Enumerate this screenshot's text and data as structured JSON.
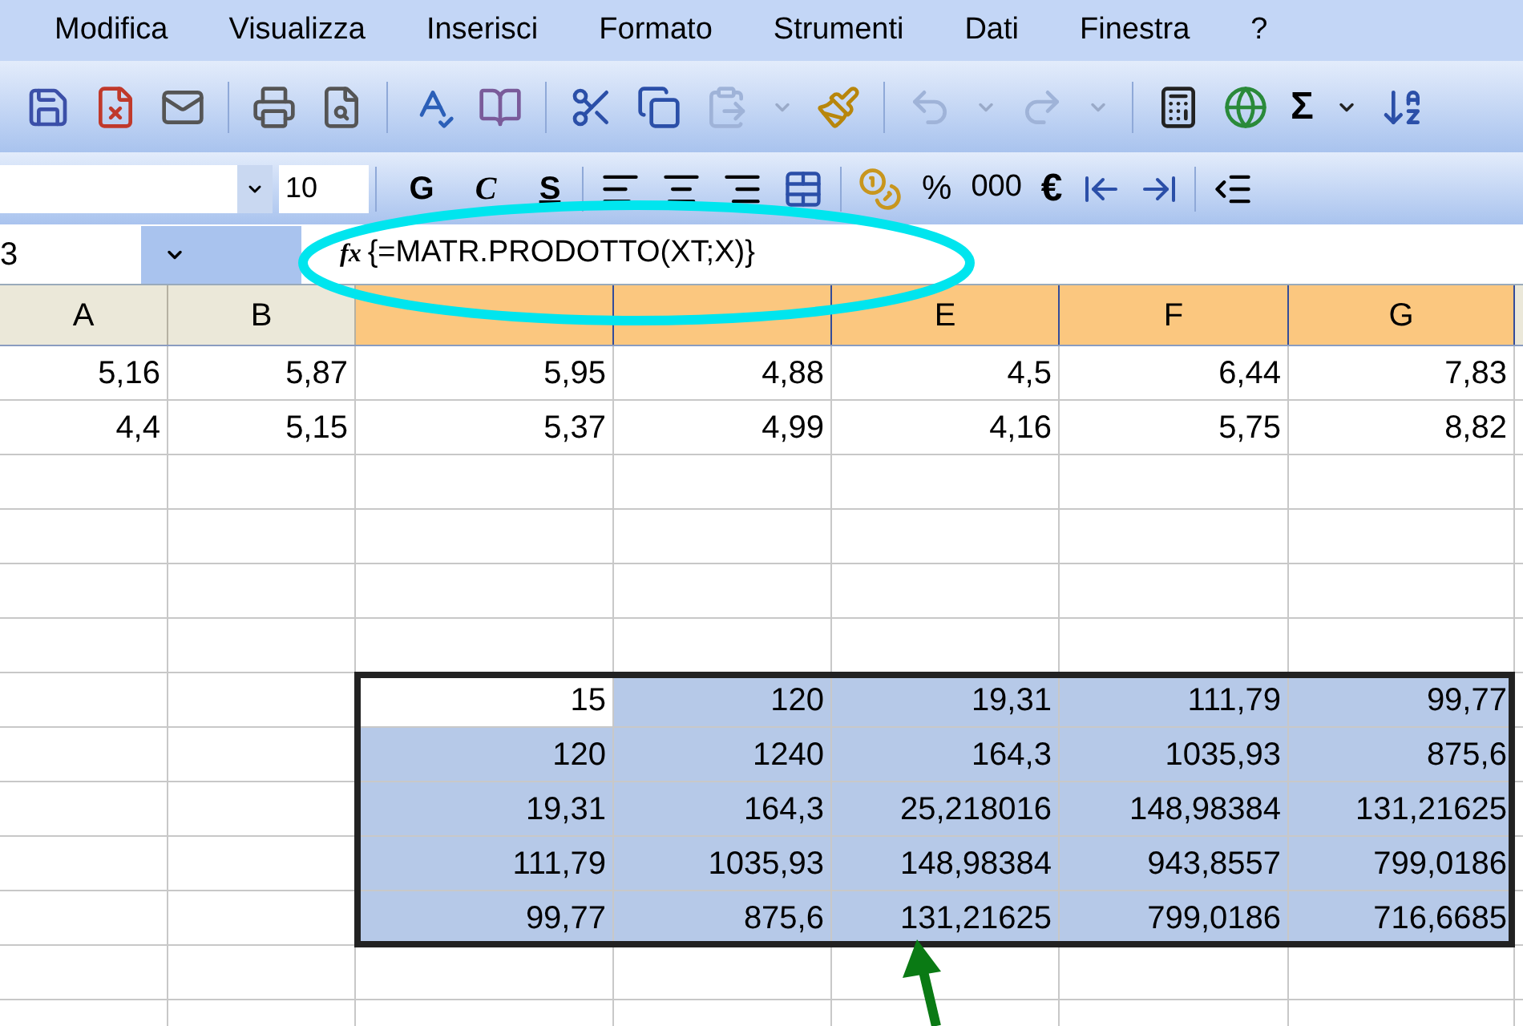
{
  "menu": [
    "Modifica",
    "Visualizza",
    "Inserisci",
    "Formato",
    "Strumenti",
    "Dati",
    "Finestra",
    "?"
  ],
  "standard_toolbar": [
    {
      "kind": "button",
      "disabled": false
    },
    {
      "kind": "button",
      "disabled": false
    },
    {
      "kind": "button",
      "disabled": false
    },
    {
      "kind": "separator"
    },
    {
      "kind": "button",
      "disabled": false
    },
    {
      "kind": "button",
      "disabled": false
    },
    {
      "kind": "separator"
    },
    {
      "kind": "button",
      "disabled": false
    },
    {
      "kind": "button",
      "disabled": false
    },
    {
      "kind": "separator"
    },
    {
      "kind": "button",
      "disabled": false
    },
    {
      "kind": "button",
      "disabled": false
    },
    {
      "kind": "button",
      "disabled": true
    },
    {
      "kind": "caret",
      "disabled": true
    },
    {
      "kind": "button",
      "disabled": false
    },
    {
      "kind": "separator"
    },
    {
      "kind": "button",
      "disabled": true
    },
    {
      "kind": "caret",
      "disabled": true
    },
    {
      "kind": "button",
      "disabled": true
    },
    {
      "kind": "caret",
      "disabled": true
    },
    {
      "kind": "separator"
    },
    {
      "kind": "button",
      "disabled": false
    },
    {
      "kind": "button",
      "disabled": false
    },
    {
      "kind": "text",
      "text": "Σ",
      "disabled": false
    },
    {
      "kind": "caret",
      "disabled": false
    },
    {
      "kind": "button",
      "disabled": false
    }
  ],
  "format_toolbar": {
    "font_size": "10",
    "bold": "G",
    "italic": "C",
    "underline": "S",
    "percent": "%",
    "thousands": "000",
    "euro": "€"
  },
  "formula_bar": {
    "name_box": "3",
    "fx": "fx",
    "formula": "{=MATR.PRODOTTO(XT;X)}"
  },
  "columns": [
    {
      "label": "A",
      "selected": false
    },
    {
      "label": "B",
      "selected": false
    },
    {
      "selected": true
    },
    {
      "selected": true
    },
    {
      "label": "E",
      "selected": true
    },
    {
      "label": "F",
      "selected": true
    },
    {
      "label": "G",
      "selected": true
    }
  ],
  "rows": [
    {
      "cells": [
        "5,16",
        "5,87",
        "5,95",
        "4,88",
        "4,5",
        "6,44",
        "7,83"
      ]
    },
    {
      "cells": [
        "4,4",
        "5,15",
        "5,37",
        "4,99",
        "4,16",
        "5,75",
        "8,82"
      ]
    },
    {
      "cells": []
    },
    {
      "cells": []
    },
    {
      "cells": []
    },
    {
      "cells": []
    },
    {
      "cells": [
        "",
        "",
        "15",
        "120",
        "19,31",
        "111,79",
        "99,77"
      ],
      "in_selection": true
    },
    {
      "cells": [
        "",
        "",
        "120",
        "1240",
        "164,3",
        "1035,93",
        "875,6"
      ],
      "in_selection": true
    },
    {
      "cells": [
        "",
        "",
        "19,31",
        "164,3",
        "25,218016",
        "148,98384",
        "131,21625"
      ],
      "in_selection": true
    },
    {
      "cells": [
        "",
        "",
        "111,79",
        "1035,93",
        "148,98384",
        "943,8557",
        "799,0186"
      ],
      "in_selection": true
    },
    {
      "cells": [
        "",
        "",
        "99,77",
        "875,6",
        "131,21625",
        "799,0186",
        "716,6685"
      ],
      "in_selection": true
    },
    {
      "cells": []
    },
    {
      "cells": []
    }
  ],
  "annotations": [
    {
      "kind": "ellipse",
      "color": "#00e5ee"
    },
    {
      "kind": "arrow",
      "color": "#0a7a14"
    }
  ]
}
